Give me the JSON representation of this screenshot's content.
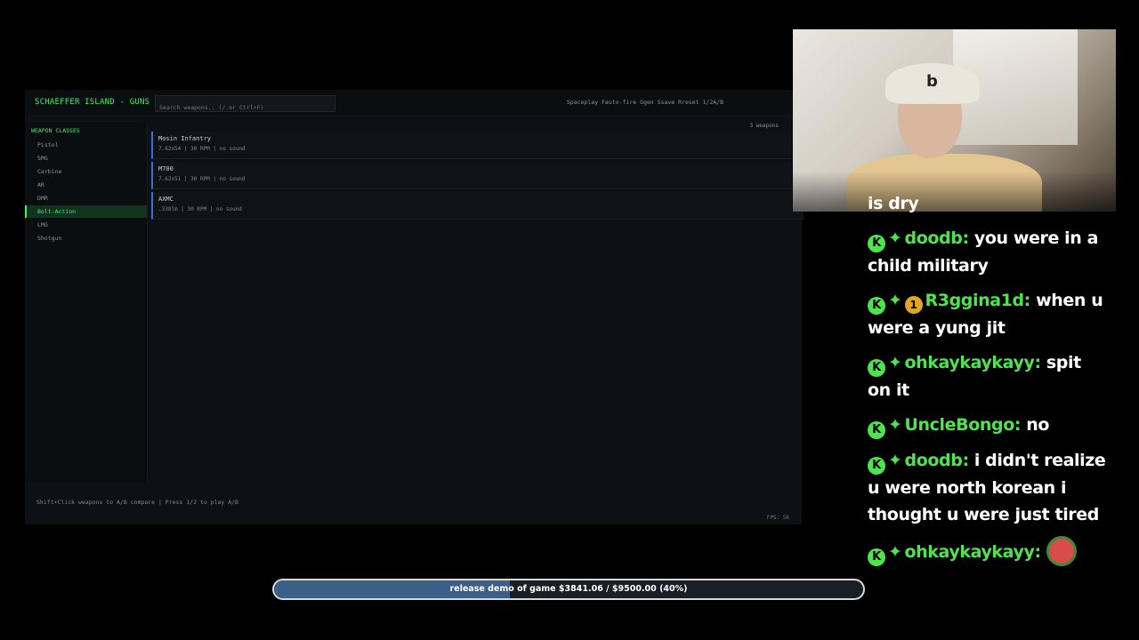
{
  "game": {
    "title": "SCHAEFFER ISLAND - GUNS",
    "search_placeholder": "Search weapons.. (/ or Ctrl+F)",
    "hotkeys": "Spaceplay  Fauto-fire  Ggen  Ssave  Rreset  1/2A/B",
    "sidebar_title": "WEAPON CLASSES",
    "classes": [
      {
        "label": "Pistol",
        "active": false
      },
      {
        "label": "SMG",
        "active": false
      },
      {
        "label": "Carbine",
        "active": false
      },
      {
        "label": "AR",
        "active": false
      },
      {
        "label": "DMR",
        "active": false
      },
      {
        "label": "Bolt-Action",
        "active": true
      },
      {
        "label": "LMG",
        "active": false
      },
      {
        "label": "Shotgun",
        "active": false
      }
    ],
    "weapon_count": "3 weapons",
    "weapons": [
      {
        "name": "Mosin Infantry",
        "meta": "7.62x54  |  30 RPM  |  no sound"
      },
      {
        "name": "M700",
        "meta": "7.62x51  |  30 RPM  |  no sound"
      },
      {
        "name": "AXMC",
        "meta": ".338lm  |  30 RPM  |  no sound"
      }
    ],
    "footer_hint": "Shift+Click weapons to A/B compare  |  Press 1/2 to play A/B",
    "fps": "FPS: 56"
  },
  "chat": {
    "messages": [
      {
        "user": "",
        "text": "is dry",
        "badges": []
      },
      {
        "user": "doodb:",
        "text": "you were in a child military",
        "badges": [
          "K",
          "diamond"
        ]
      },
      {
        "user": "R3ggina1d:",
        "text": "when u were a yung jit",
        "badges": [
          "K",
          "diamond",
          "1"
        ]
      },
      {
        "user": "ohkaykaykayy:",
        "text": "spit on it",
        "badges": [
          "K",
          "diamond"
        ]
      },
      {
        "user": "UncleBongo:",
        "text": "no",
        "badges": [
          "K",
          "diamond"
        ]
      },
      {
        "user": "doodb:",
        "text": "i didn't realize u were north korean i thought u were just tired",
        "badges": [
          "K",
          "diamond"
        ]
      },
      {
        "user": "ohkaykaykayy:",
        "text": "",
        "badges": [
          "K",
          "diamond"
        ],
        "emote": true
      }
    ]
  },
  "goal": {
    "text": "release demo of game $3841.06 / $9500.00 (40%)",
    "progress": 0.4,
    "fill_color": "#3b5f86"
  },
  "colors": {
    "accent": "#3ff06a",
    "chat_user": "#4ee44e",
    "weapon_border": "#3b6fd6"
  }
}
